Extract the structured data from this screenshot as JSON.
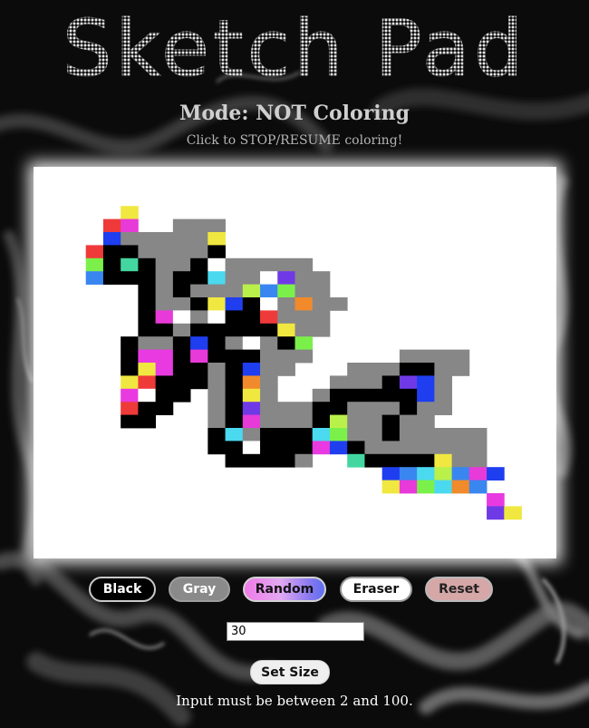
{
  "app": {
    "title": "Sketch Pad",
    "mode_text": "Mode: NOT Coloring",
    "hint_text": "Click to STOP/RESUME coloring!"
  },
  "buttons": {
    "black": "Black",
    "gray": "Gray",
    "random": "Random",
    "eraser": "Eraser",
    "reset": "Reset",
    "set_size": "Set Size"
  },
  "size_input": {
    "value": "30"
  },
  "validation_note": "Input must be between 2 and 100.",
  "grid": {
    "size": 30,
    "colors": {
      "K": "#000000",
      "G": "#878787",
      "W": "#ffffff"
    },
    "rows": [
      "..............................",
      "..............................",
      "..............................",
      ".....?........................",
      "....??..GGG...................",
      "....?GGGGG?...................",
      "...?KKGGGGK...................",
      "...?K?KGGKWGGGGG..............",
      "...?KKKGKK?GGW?GG.............",
      "......KGKGGG???GG.............",
      "......KGGK??KWG?GG............",
      "......K?WGWKK?GGG.............",
      "......KKGKKKKK?GG.............",
      ".....KGGK?KGWGK?..............",
      ".....K??K?KKKGGG.....GGGG.....",
      ".....K??KKGK?GG...GGGKKGG.....",
      ".....??KKKGK?G...GGGK??G......",
      ".....?WKK.GK?G..GKKKKK?G......",
      ".....?KK..GK?GGGKKGGGKGG......",
      ".....KK...GK?GGGK?GGKGG.......",
      "..........K?GKKK??GGKGGGGG....",
      "..........KKWKKK??KGGGGGGG....",
      "...........KKKKG..?KKKK?GG....",
      "....................???????...",
      "....................??????....",
      "..........................?..",
      "..........................??..",
      "..............................",
      "..............................",
      ".............................."
    ]
  }
}
